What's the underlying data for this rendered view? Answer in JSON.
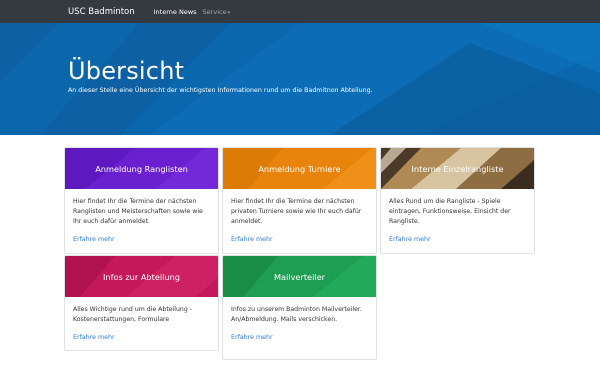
{
  "navbar": {
    "brand": "USC Badminton",
    "items": [
      {
        "label": "Interne News"
      },
      {
        "label": "Service",
        "caret": "▾"
      }
    ]
  },
  "hero": {
    "title": "Übersicht",
    "lead": "An dieser Stelle eine Übersicht der wichtigsten Informationen rund um die Badmitnon Abteilung."
  },
  "cards": [
    {
      "title": "Anmeldung Ranglisten",
      "text": "Hier findet Ihr die Termine der nächsten Ranglisten und Meisterschaften sowie wie Ihr euch dafür anmeldet.",
      "link": "Erfahre mehr",
      "color": "#6a1fd0"
    },
    {
      "title": "Anmeldung Turniere",
      "text": "Hier findet Ihr die Termine der nächsten privaten Turniere sowie wie Ihr euch dafür anmeldet.",
      "link": "Erfahre mehr",
      "color": "#e8840b"
    },
    {
      "title": "Interne Einzelrangliste",
      "text": "Alles Rund um die Rangliste - Spiele eintragen, Funktionsweise, Einsicht der Rangliste.",
      "link": "Erfahre mehr",
      "color": "#8a6a3e"
    },
    {
      "title": "Infos zur Abteilung",
      "text": "Alles Wichtige rund um die Abteilung - Kostenerstattungen, Formulare",
      "link": "Erfahre mehr",
      "color": "#c4185b"
    },
    {
      "title": "Mailverteiler",
      "text": "Infos zu unserem Badminton Mailverteiler. An/Abmeldung. Mails verschicken.",
      "link": "Erfahre mehr",
      "color": "#1e9e52"
    }
  ],
  "colors": {
    "navbar": "#343a40",
    "hero": "#0a67ad",
    "link": "#2f7bd6"
  }
}
